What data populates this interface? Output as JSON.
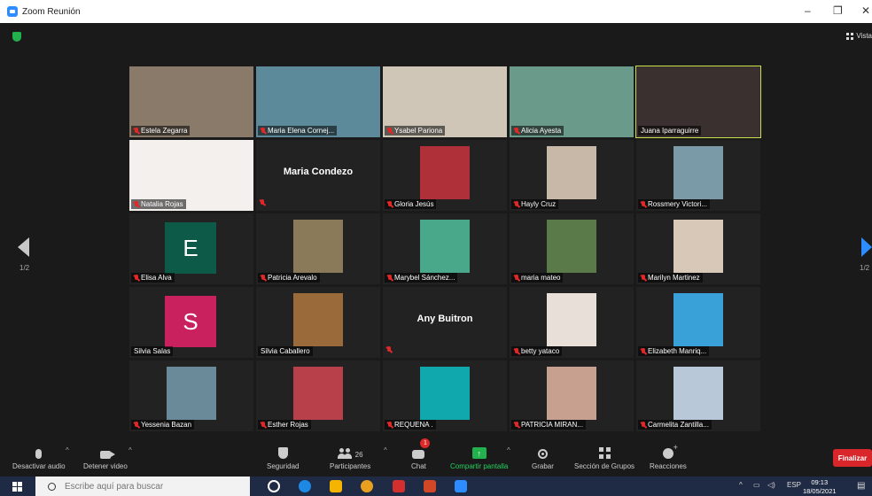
{
  "window": {
    "title": "Zoom Reunión",
    "minimize": "–",
    "maximize": "❐",
    "close": "✕"
  },
  "view": {
    "label": "Vista"
  },
  "pager": {
    "left": "1/2",
    "right": "1/2"
  },
  "participants": [
    {
      "name": "Estela Zegarra",
      "muted": true,
      "kind": "video",
      "bg": "#8a7a6a"
    },
    {
      "name": "Maria Elena Cornej...",
      "muted": true,
      "kind": "video",
      "bg": "#5c8a9a"
    },
    {
      "name": "Ysabel Pariona",
      "muted": true,
      "kind": "video",
      "bg": "#cfc6b8"
    },
    {
      "name": "Alicia Ayesta",
      "muted": true,
      "kind": "video",
      "bg": "#6a9a8a"
    },
    {
      "name": "Juana Iparraguirre",
      "muted": false,
      "kind": "video",
      "bg": "#3a3030",
      "active": true
    },
    {
      "name": "Natalia Rojas",
      "muted": true,
      "kind": "video",
      "bg": "#f3f0ee"
    },
    {
      "name": "Maria Condezo",
      "muted": true,
      "kind": "name",
      "display": "Maria Condezo"
    },
    {
      "name": "Gloria Jesús",
      "muted": true,
      "kind": "photo",
      "bg": "#b0303a"
    },
    {
      "name": "Hayly Cruz",
      "muted": true,
      "kind": "photo",
      "bg": "#c8b8a8"
    },
    {
      "name": "Rossmery Victori...",
      "muted": true,
      "kind": "photo",
      "bg": "#7a9aa8"
    },
    {
      "name": "Elisa Alva",
      "muted": true,
      "kind": "letter",
      "letter": "E",
      "color": "#0e5a48"
    },
    {
      "name": "Patricia Arevalo",
      "muted": true,
      "kind": "photo",
      "bg": "#8a7a5a"
    },
    {
      "name": "Marybel Sánchez...",
      "muted": true,
      "kind": "photo",
      "bg": "#4aa88a"
    },
    {
      "name": "maria mateo",
      "muted": true,
      "kind": "photo",
      "bg": "#5a7a4a"
    },
    {
      "name": "Marilyn Martinez",
      "muted": true,
      "kind": "photo",
      "bg": "#d8c8b8"
    },
    {
      "name": "Silvia Salas",
      "muted": false,
      "kind": "letter",
      "letter": "S",
      "color": "#c8215e"
    },
    {
      "name": "Silvia Caballero",
      "muted": false,
      "kind": "photo",
      "bg": "#9a6a3a"
    },
    {
      "name": "Any Buitron",
      "muted": true,
      "kind": "name",
      "display": "Any Buitron"
    },
    {
      "name": "betty yataco",
      "muted": true,
      "kind": "photo",
      "bg": "#e8e0d8"
    },
    {
      "name": "Elizabeth Manriq...",
      "muted": true,
      "kind": "photo",
      "bg": "#3aa0d8"
    },
    {
      "name": "Yessenia Bazan",
      "muted": true,
      "kind": "photo",
      "bg": "#6a8a9a"
    },
    {
      "name": "Esther Rojas",
      "muted": true,
      "kind": "photo",
      "bg": "#b8404a"
    },
    {
      "name": "REQUENA .",
      "muted": true,
      "kind": "photo",
      "bg": "#11a8ad"
    },
    {
      "name": "PATRICIA MIRAN...",
      "muted": true,
      "kind": "photo",
      "bg": "#c8a090"
    },
    {
      "name": "Carmelita Zantilla...",
      "muted": true,
      "kind": "photo",
      "bg": "#b8c8d8"
    }
  ],
  "toolbar": {
    "mute": "Desactivar audio",
    "video": "Detener video",
    "security": "Seguridad",
    "participants": "Participantes",
    "participants_count": "26",
    "chat": "Chat",
    "chat_badge": "1",
    "share": "Compartir pantalla",
    "record": "Grabar",
    "breakout": "Sección de Grupos",
    "reactions": "Reacciones",
    "end": "Finalizar"
  },
  "taskbar": {
    "search_placeholder": "Escribe aquí para buscar",
    "lang": "ESP",
    "time": "09:13",
    "date": "18/05/2021"
  },
  "colors": {
    "accent": "#2d8cff",
    "share_green": "#23d160",
    "end_red": "#d9262b",
    "active_border": "#c8e04a"
  }
}
